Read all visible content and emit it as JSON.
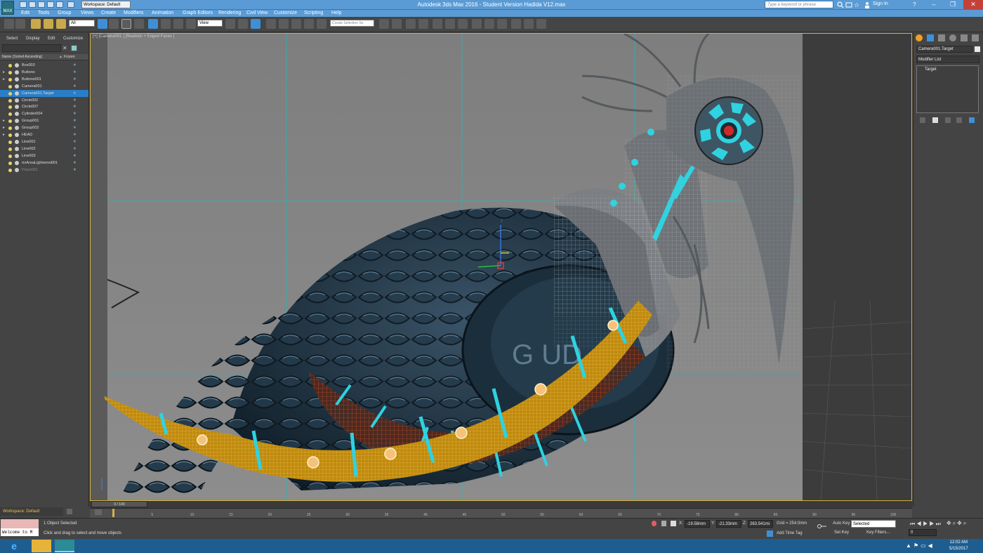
{
  "title_bar": {
    "app_logo": "MAX",
    "title": "Autodesk 3ds Max 2016 - Student Version    Hadida V12.max",
    "workspace": "Workspace: Default",
    "search_placeholder": "Type a keyword or phrase",
    "sign_in": "Sign In",
    "minimize": "–",
    "maximize": "❐",
    "close": "✕"
  },
  "menu": {
    "items": [
      "Edit",
      "Tools",
      "Group",
      "Views",
      "Create",
      "Modifiers",
      "Animation",
      "Graph Editors",
      "Rendering",
      "Civil View",
      "Customize",
      "Scripting",
      "Help"
    ]
  },
  "toolbar": {
    "selection_filter": "All",
    "ref_coord": "View",
    "selection_set": "Create Selection Se"
  },
  "explorer": {
    "tabs": [
      "Select",
      "Display",
      "Edit",
      "Customize"
    ],
    "col_name": "Name (Sorted Ascending)",
    "col_frozen": "Frozen",
    "rows": [
      {
        "name": "Box003",
        "selected": false
      },
      {
        "name": "Buttons",
        "selected": false
      },
      {
        "name": "Buttons001",
        "selected": false
      },
      {
        "name": "Camera001",
        "selected": false
      },
      {
        "name": "Camera001.Target",
        "selected": true
      },
      {
        "name": "Circle002",
        "selected": false
      },
      {
        "name": "Circle007",
        "selected": false
      },
      {
        "name": "Cylinder004",
        "selected": false
      },
      {
        "name": "Group001",
        "selected": false
      },
      {
        "name": "Group002",
        "selected": false
      },
      {
        "name": "HEAD",
        "selected": false
      },
      {
        "name": "Line001",
        "selected": false
      },
      {
        "name": "Line002",
        "selected": false
      },
      {
        "name": "Line003",
        "selected": false
      },
      {
        "name": "mrAreaLightomni001",
        "selected": false
      },
      {
        "name": "Plane001",
        "selected": false
      }
    ],
    "workspace": "Workspace: Default"
  },
  "viewport": {
    "label": "[+] [Camera001 ] [Realistic + Edged Faces ]",
    "colors": {
      "body": "#1f3443",
      "wire": "#8a8f94",
      "cyan": "#2fd2e0",
      "gold": "#d6a11a",
      "orange": "#c7421d"
    }
  },
  "command_panel": {
    "object_name": "Camera001.Target",
    "modifier_list": "Modifier List",
    "stack_item": "Target"
  },
  "timeline": {
    "slider": "0 / 100",
    "ticks": [
      "0",
      "5",
      "10",
      "15",
      "20",
      "25",
      "30",
      "35",
      "40",
      "45",
      "50",
      "55",
      "60",
      "65",
      "70",
      "75",
      "80",
      "85",
      "90",
      "95",
      "100"
    ]
  },
  "status": {
    "welcome": "Welcome to M",
    "selected": "1 Object Selected",
    "prompt": "Click and drag to select and move objects",
    "x_label": "X:",
    "x": "-19.58mm",
    "y_label": "Y:",
    "y": "-21.33mm",
    "z_label": "Z:",
    "z": "263.541mi",
    "grid": "Grid = 254.0mm",
    "add_time_tag": "Add Time Tag",
    "auto_key": "Auto Key",
    "set_key": "Set Key",
    "selected_dd": "Selected",
    "key_filters": "Key Filters...",
    "frame": "0"
  },
  "taskbar": {
    "clock_time": "12:02 AM",
    "clock_date": "5/15/2017"
  }
}
